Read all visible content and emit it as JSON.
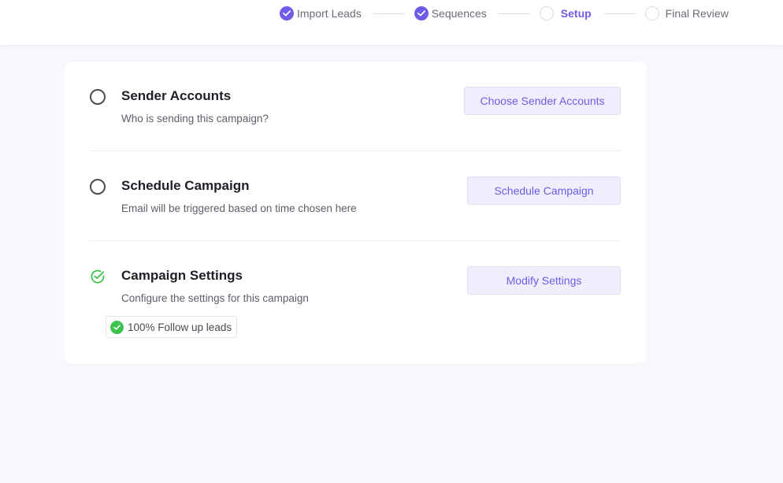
{
  "stepper": {
    "steps": [
      {
        "label": "Import Leads",
        "status": "completed"
      },
      {
        "label": "Sequences",
        "status": "completed"
      },
      {
        "label": "Setup",
        "status": "active"
      },
      {
        "label": "Final Review",
        "status": "pending"
      }
    ]
  },
  "sections": [
    {
      "title": "Sender Accounts",
      "subtitle": "Who is sending this campaign?",
      "button_label": "Choose Sender Accounts",
      "status": "incomplete"
    },
    {
      "title": "Schedule Campaign",
      "subtitle": "Email will be triggered based on time chosen here",
      "button_label": "Schedule Campaign",
      "status": "incomplete"
    },
    {
      "title": "Campaign Settings",
      "subtitle": "Configure the settings for this campaign",
      "button_label": "Modify Settings",
      "status": "complete",
      "badge": "100% Follow up leads"
    }
  ],
  "colors": {
    "accent": "#6e5ce6",
    "success": "#3ec24f",
    "page_background": "#f7f7fc"
  },
  "icons": {
    "completed_step": "check-circle-icon",
    "pending_step": "empty-circle-icon",
    "section_incomplete": "radio-empty-icon",
    "section_complete": "check-circle-outline-icon",
    "badge": "check-circle-filled-icon"
  }
}
